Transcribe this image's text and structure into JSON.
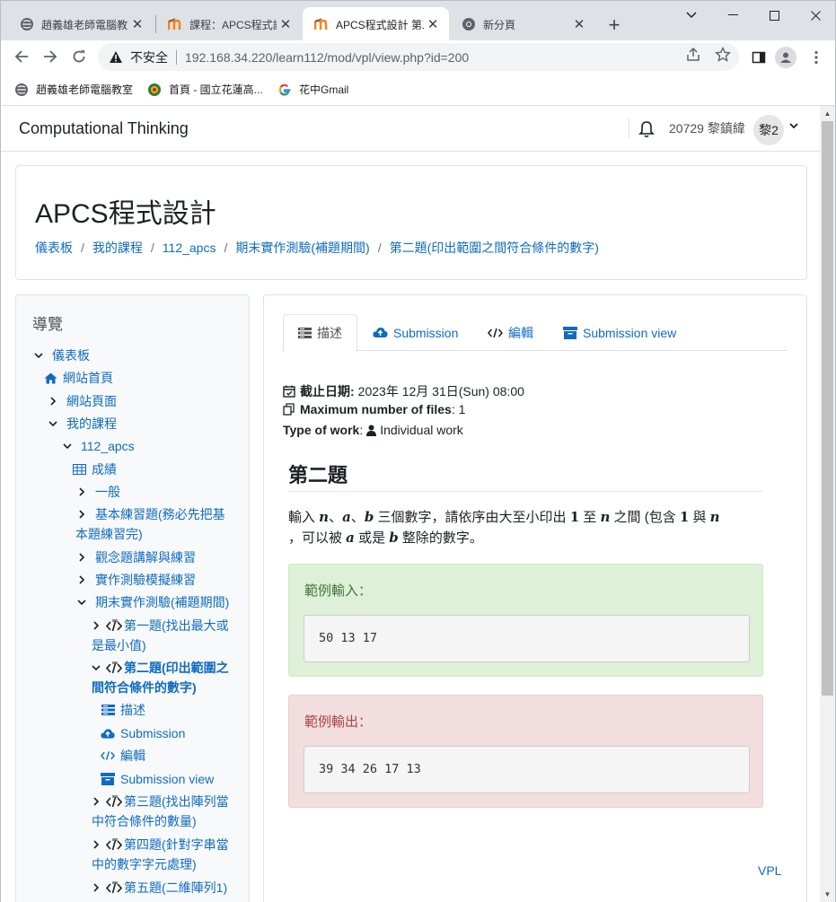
{
  "browser": {
    "tabs": [
      {
        "title": "趙義雄老師電腦教室"
      },
      {
        "title": "課程：APCS程式設計"
      },
      {
        "title": "APCS程式設計 第二題(印出範圍之間符合條件的數字)"
      },
      {
        "title": "新分頁"
      }
    ],
    "omnibox": {
      "security_label": "不安全",
      "url": "192.168.34.220/learn112/mod/vpl/view.php?id=200"
    },
    "bookmarks": [
      {
        "label": "趙義雄老師電腦教室"
      },
      {
        "label": "首頁 - 國立花蓮高..."
      },
      {
        "label": "花中Gmail"
      }
    ]
  },
  "site": {
    "brand": "Computational Thinking",
    "user_name": "20729 黎鎮緯",
    "user_initials": "黎2"
  },
  "header": {
    "title": "APCS程式設計",
    "breadcrumb": [
      "儀表板",
      "我的課程",
      "112_apcs",
      "期末實作測驗(補題期間)",
      "第二題(印出範圍之間符合條件的數字)"
    ]
  },
  "drawer": {
    "title": "導覽",
    "items": [
      {
        "label": "儀表板"
      },
      {
        "label": "網站首頁"
      },
      {
        "label": "網站頁面"
      },
      {
        "label": "我的課程"
      },
      {
        "label": "112_apcs"
      },
      {
        "label": "成績"
      },
      {
        "label": "一般"
      },
      {
        "label": "基本練習題(務必先把基本題練習完)"
      },
      {
        "label": "觀念題講解與練習"
      },
      {
        "label": "實作測驗模擬練習"
      },
      {
        "label": "期末實作測驗(補題期間)"
      },
      {
        "label": "第一題(找出最大或是最小值)"
      },
      {
        "label": "第二題(印出範圍之間符合條件的數字)"
      },
      {
        "label": "描述"
      },
      {
        "label": "Submission"
      },
      {
        "label": "編輯"
      },
      {
        "label": "Submission view"
      },
      {
        "label": "第三題(找出陣列當中符合條件的數量)"
      },
      {
        "label": "第四題(針對字串當中的數字字元處理)"
      },
      {
        "label": "第五題(二維陣列1)"
      }
    ]
  },
  "main": {
    "tabs": [
      {
        "label": "描述"
      },
      {
        "label": "Submission"
      },
      {
        "label": "編輯"
      },
      {
        "label": "Submission view"
      }
    ],
    "meta": {
      "due_label": "截止日期:",
      "due_value": "2023年 12月 31日(Sun) 08:00",
      "files_label": "Maximum number of files",
      "files_value": ": 1",
      "type_label": "Type of work",
      "type_value": "Individual work"
    },
    "question": {
      "title": "第二題",
      "p1": "輸入 ",
      "v_n": "n",
      "p2": "、",
      "v_a": "a",
      "p3": "、",
      "v_b": "b",
      "p4": " 三個數字，請依序由大至小印出 ",
      "num_1": "1",
      "p5": " 至 ",
      "v_n2": "n",
      "p6": " 之間 (包含 ",
      "num_1b": "1",
      "p7": " 與 ",
      "v_n3": "n",
      "p8": "，可以被 ",
      "v_a2": "a",
      "p9": " 或是 ",
      "v_b2": "b",
      "p10": " 整除的數字。"
    },
    "sample_input": {
      "label": "範例輸入：",
      "value": "50 13 17"
    },
    "sample_output": {
      "label": "範例輸出：",
      "value": "39 34 26 17 13"
    },
    "footer_link": "VPL"
  }
}
